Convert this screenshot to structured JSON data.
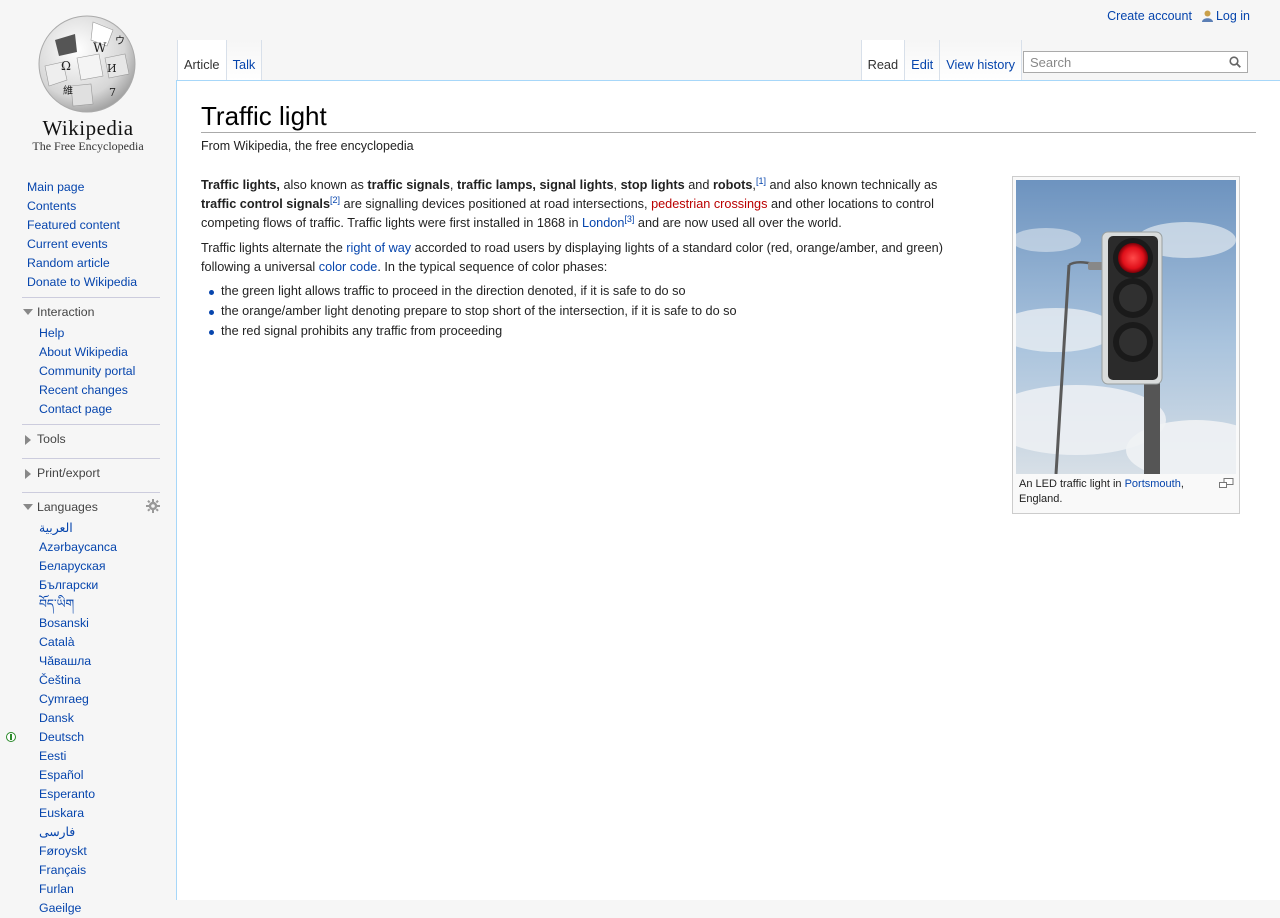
{
  "personal_tools": {
    "create_account": "Create account",
    "log_in": "Log in"
  },
  "logo": {
    "wordmark": "Wikipedia",
    "tagline": "The Free Encyclopedia"
  },
  "navigation": [
    "Main page",
    "Contents",
    "Featured content",
    "Current events",
    "Random article",
    "Donate to Wikipedia"
  ],
  "interaction": {
    "heading": "Interaction",
    "items": [
      "Help",
      "About Wikipedia",
      "Community portal",
      "Recent changes",
      "Contact page"
    ]
  },
  "tools": {
    "heading": "Tools"
  },
  "print_export": {
    "heading": "Print/export"
  },
  "languages": {
    "heading": "Languages",
    "items": [
      "العربية",
      "Azərbaycanca",
      "Беларуская",
      "Български",
      "བོད་ཡིག",
      "Bosanski",
      "Català",
      "Чӑвашла",
      "Čeština",
      "Cymraeg",
      "Dansk",
      "Deutsch",
      "Eesti",
      "Español",
      "Esperanto",
      "Euskara",
      "فارسی",
      "Føroyskt",
      "Français",
      "Furlan",
      "Gaeilge"
    ],
    "featured": "Deutsch"
  },
  "tabs": {
    "article": "Article",
    "talk": "Talk",
    "read": "Read",
    "edit": "Edit",
    "view_history": "View history"
  },
  "search": {
    "placeholder": "Search"
  },
  "article": {
    "title": "Traffic light",
    "tagline": "From Wikipedia, the free encyclopedia",
    "p1": {
      "b1": "Traffic lights,",
      "t1": " also known as ",
      "b2": "traffic signals",
      "t2": ", ",
      "b3": "traffic lamps,",
      "t3": " ",
      "b4": "signal lights",
      "t4": ", ",
      "b5": "stop lights",
      "t5": " and ",
      "b6": "robots",
      "t6": ",",
      "ref1": "[1]",
      "t7": " and also known technically as ",
      "b7": "traffic control signals",
      "ref2": "[2]",
      "t8": " are signalling devices positioned at road intersections, ",
      "link1": "pedestrian crossings",
      "t9": " and other locations to control competing flows of traffic. Traffic lights were first installed in 1868 in ",
      "link2": "London",
      "ref3": "[3]",
      "t10": " and are now used all over the world."
    },
    "p2": {
      "t1": "Traffic lights alternate the ",
      "link1": "right of way",
      "t2": " accorded to road users by displaying lights of a standard color (red, orange/amber, and green) following a universal ",
      "link2": "color code",
      "t3": ". In the typical sequence of color phases:"
    },
    "bullets": [
      "the green light allows traffic to proceed in the direction denoted, if it is safe to do so",
      "the orange/amber light denoting prepare to stop short of the intersection, if it is safe to do so",
      "the red signal prohibits any traffic from proceeding"
    ],
    "image_caption": {
      "t1": "An LED traffic light in ",
      "link": "Portsmouth",
      "t2": ", England."
    }
  },
  "colors": {
    "link": "#0645ad",
    "redlink": "#ba0000",
    "border": "#a7d7f9"
  }
}
